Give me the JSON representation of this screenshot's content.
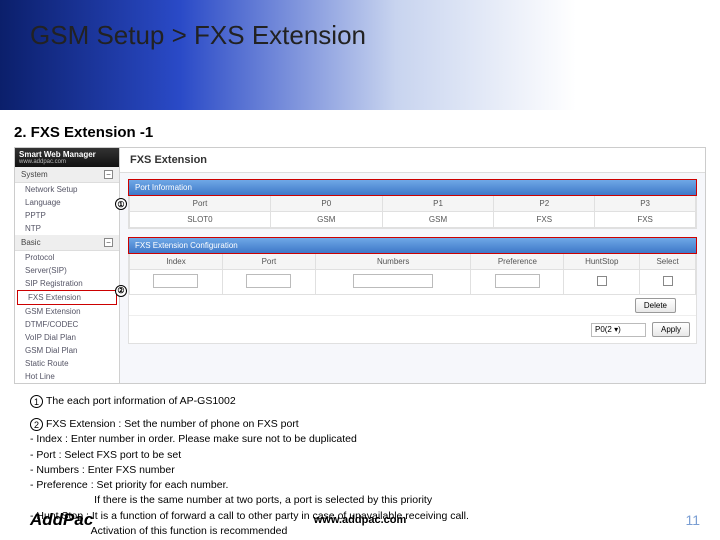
{
  "title": "GSM Setup > FXS Extension",
  "subtitle": "2. FXS Extension -1",
  "sidebar": {
    "brand": "Smart Web Manager",
    "brandSub": "www.addpac.com",
    "groups": [
      {
        "title": "System",
        "items": [
          "Network Setup",
          "Language",
          "PPTP",
          "NTP"
        ]
      },
      {
        "title": "Basic",
        "items": [
          "Protocol",
          "Server(SIP)",
          "SIP Registration",
          "FXS Extension",
          "GSM Extension",
          "DTMF/CODEC",
          "VoIP Dial Plan",
          "GSM Dial Plan",
          "Static Route",
          "Hot Line"
        ]
      }
    ],
    "highlightItem": "FXS Extension"
  },
  "main": {
    "heading": "FXS Extension",
    "panel1": {
      "title": "Port Information",
      "cols": [
        "Port",
        "P0",
        "P1",
        "P2",
        "P3"
      ],
      "rows": [
        [
          "SLOT0",
          "GSM",
          "GSM",
          "FXS",
          "FXS"
        ]
      ]
    },
    "panel2": {
      "title": "FXS Extension Configuration",
      "cols": [
        "Index",
        "Port",
        "Numbers",
        "Preference",
        "HuntStop",
        "Select"
      ],
      "rowInputs": {
        "index": "",
        "port": "",
        "numbers": "",
        "preference": "",
        "huntstop": "checkbox",
        "select": "checkbox"
      },
      "deleteBtn": "Delete",
      "addPortSel": "P0(2 ▾)",
      "applyBtn": "Apply"
    }
  },
  "notes": {
    "n1": "The each port information of AP-GS1002",
    "n2": {
      "head": "FXS Extension : Set the number of phone on FXS port",
      "lines": [
        "- Index : Enter number in order. Please make sure not to be duplicated",
        "- Port : Select FXS port to be set",
        "- Numbers : Enter FXS number",
        "- Preference : Set priority for each number.",
        "                      If there is the same number at two ports, a port is selected by this priority",
        "- Hunt Stop : It is a function of forward a call to other party in case of unavailable receiving call.",
        "                     Activation of this function is recommended"
      ]
    }
  },
  "footer": {
    "logo": "AddPac",
    "url": "www.addpac.com",
    "page": "11"
  },
  "badges": {
    "b1": "①",
    "b2": "②"
  }
}
